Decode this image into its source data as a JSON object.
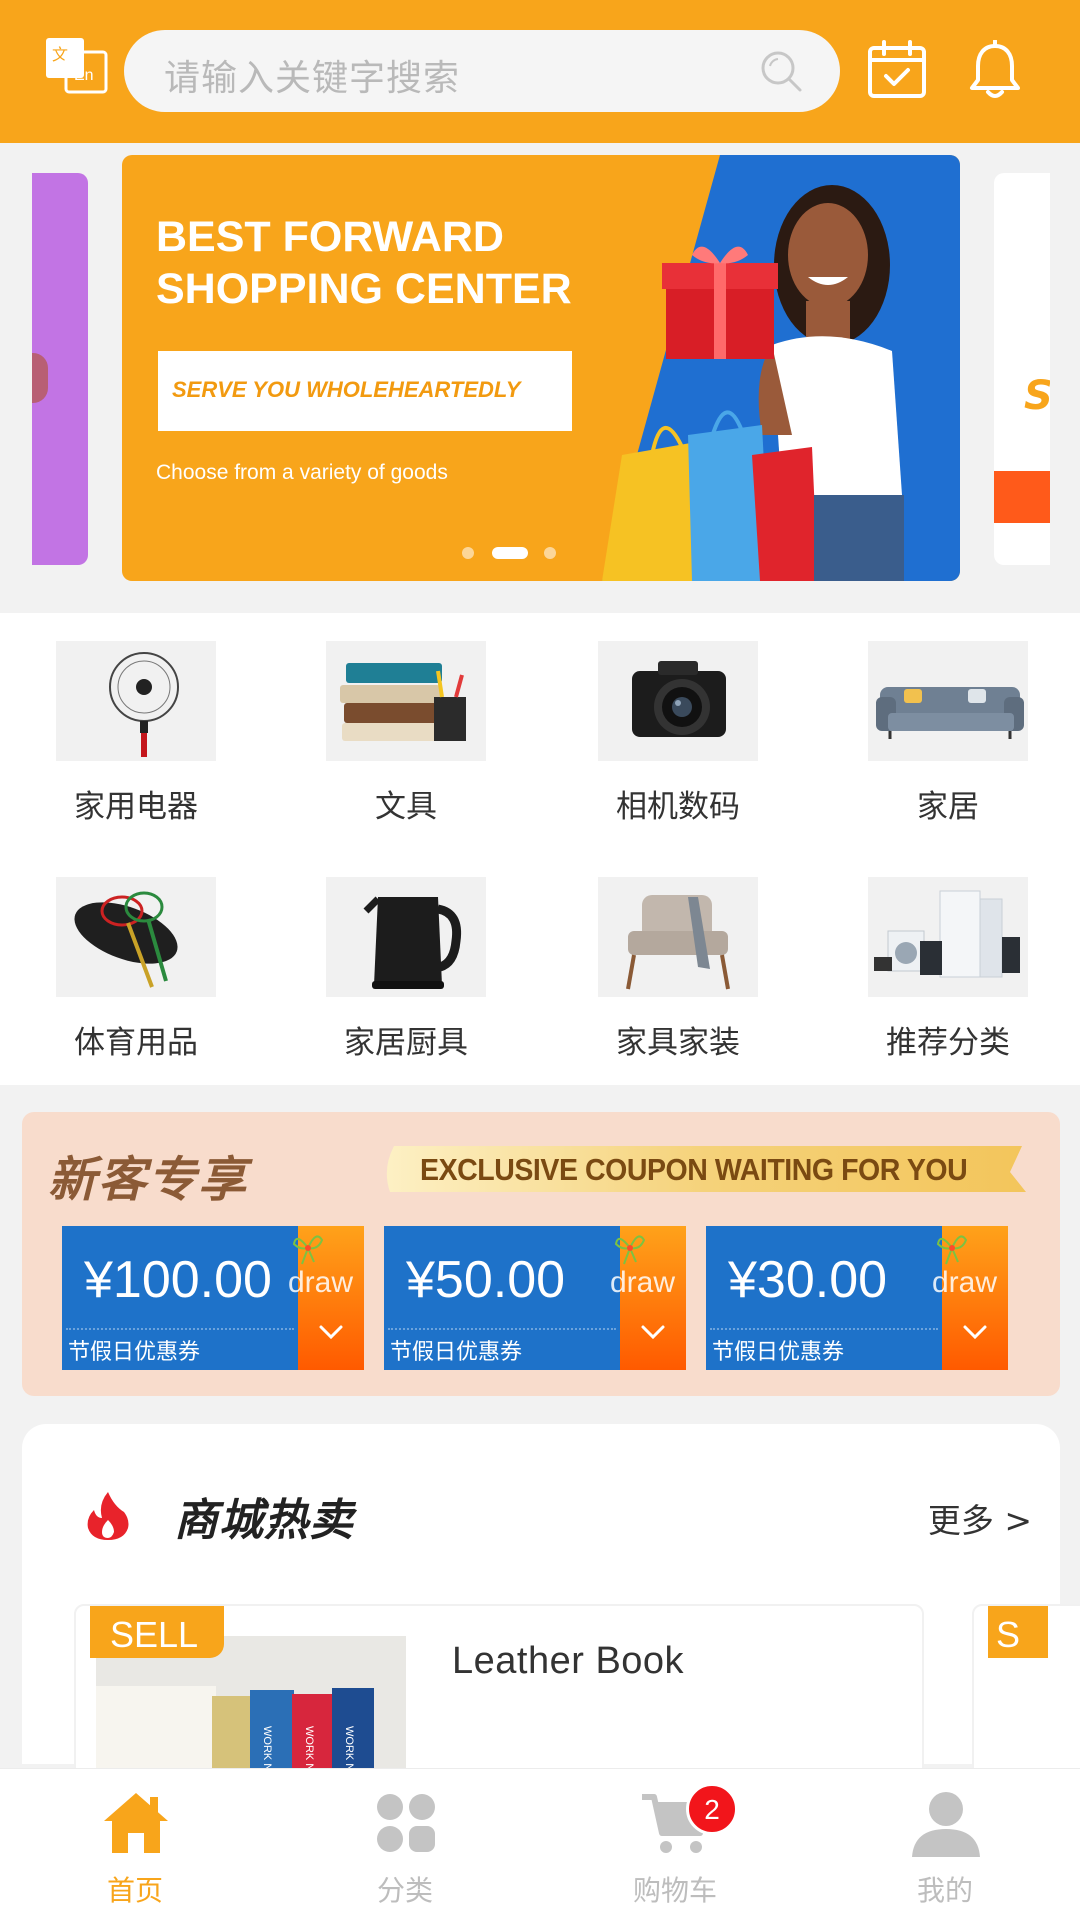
{
  "search": {
    "placeholder": "请输入关键字搜索"
  },
  "header": {
    "icons": [
      "translate-icon",
      "search-icon",
      "checkin-calendar-icon",
      "bell-icon"
    ]
  },
  "banner": {
    "title_line1": "BEST FORWARD",
    "title_line2": "SHOPPING CENTER",
    "tagline": "SERVE YOU WHOLEHEARTEDLY",
    "subtitle": "Choose from a variety of goods",
    "active_slide_index": 1,
    "slide_count": 3
  },
  "categories": [
    {
      "label": "家用电器",
      "icon": "electric-fan"
    },
    {
      "label": "文具",
      "icon": "books"
    },
    {
      "label": "相机数码",
      "icon": "camera"
    },
    {
      "label": "家居",
      "icon": "sofa"
    },
    {
      "label": "体育用品",
      "icon": "badminton-rackets"
    },
    {
      "label": "家居厨具",
      "icon": "kettle"
    },
    {
      "label": "家具家装",
      "icon": "armchair"
    },
    {
      "label": "推荐分类",
      "icon": "appliances"
    }
  ],
  "coupons": {
    "heading": "新客专享",
    "ribbon": "EXCLUSIVE COUPON WAITING FOR YOU",
    "items": [
      {
        "amount": "¥100.00",
        "action": "draw",
        "label": "节假日优惠券"
      },
      {
        "amount": "¥50.00",
        "action": "draw",
        "label": "节假日优惠券"
      },
      {
        "amount": "¥30.00",
        "action": "draw",
        "label": "节假日优惠券"
      }
    ]
  },
  "hot": {
    "title": "商城热卖",
    "more": "更多 >",
    "tag": "SELL",
    "tag_partial": "S",
    "products": [
      {
        "name": "Leather Book"
      }
    ]
  },
  "tabbar": {
    "items": [
      {
        "label": "首页",
        "icon": "home-icon",
        "active": true
      },
      {
        "label": "分类",
        "icon": "grid-icon",
        "active": false
      },
      {
        "label": "购物车",
        "icon": "cart-icon",
        "active": false
      },
      {
        "label": "我的",
        "icon": "user-icon",
        "active": false
      }
    ],
    "cart_badge": "2"
  },
  "colors": {
    "accent": "#f8a51b",
    "coupon_blue": "#1e72c9",
    "badge_red": "#f2151b"
  }
}
